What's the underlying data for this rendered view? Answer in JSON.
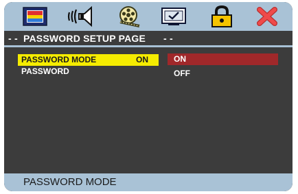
{
  "tabs": [
    {
      "name": "picture-icon"
    },
    {
      "name": "speaker-icon"
    },
    {
      "name": "film-reel-icon"
    },
    {
      "name": "monitor-check-icon"
    },
    {
      "name": "padlock-icon",
      "active": true
    },
    {
      "name": "close-x-icon"
    }
  ],
  "header": {
    "prefix": "- - ",
    "title": "PASSWORD SETUP  PAGE",
    "suffix": " - -"
  },
  "menu": {
    "items": [
      {
        "label": "PASSWORD MODE",
        "value": "ON",
        "selected": true
      },
      {
        "label": "PASSWORD",
        "value": ""
      }
    ]
  },
  "options": [
    {
      "label": "ON",
      "highlighted": true
    },
    {
      "label": "OFF",
      "highlighted": false
    }
  ],
  "status": {
    "text": "PASSWORD MODE"
  },
  "colors": {
    "panel_bg": "#3c3c3c",
    "bar_bg": "#a9c2d6",
    "selected_row": "#f5ec00",
    "highlighted_option": "#a0282a",
    "close_icon": "#ef4a4a",
    "lock_icon": "#f5c400"
  }
}
